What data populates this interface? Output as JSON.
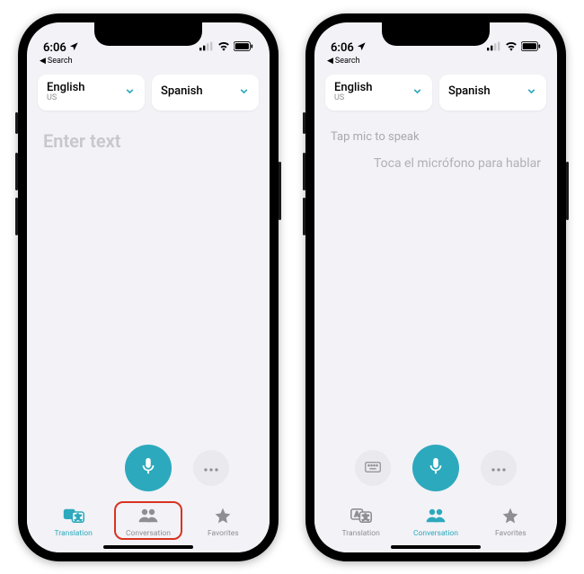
{
  "status": {
    "time": "6:06",
    "back_label": "Search"
  },
  "lang": {
    "source": {
      "name": "English",
      "sub": "US"
    },
    "target": {
      "name": "Spanish",
      "sub": ""
    }
  },
  "left": {
    "placeholder": "Enter text"
  },
  "right": {
    "prompt_en": "Tap mic to speak",
    "prompt_es": "Toca el micrófono para hablar"
  },
  "tabs": {
    "translation": "Translation",
    "conversation": "Conversation",
    "favorites": "Favorites"
  },
  "colors": {
    "accent": "#2ca9bc",
    "highlight": "#d9331f"
  }
}
